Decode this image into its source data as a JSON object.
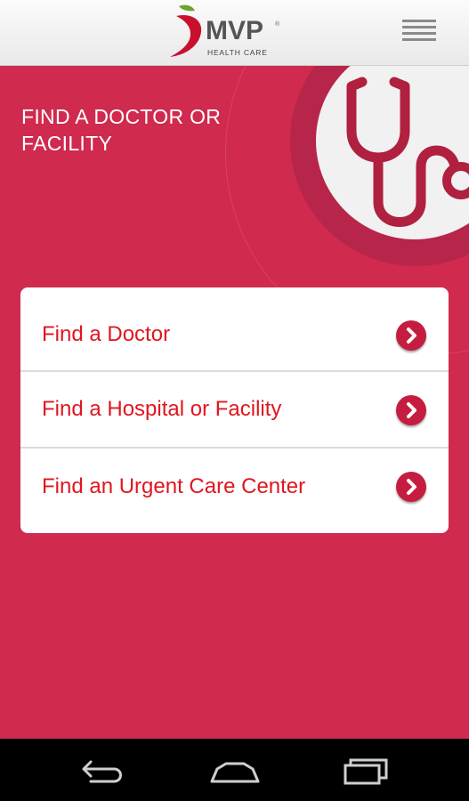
{
  "header": {
    "logo_text": "MVP",
    "logo_registered": "®",
    "logo_subtitle": "HEALTH CARE",
    "menu_icon": "hamburger-menu-icon"
  },
  "hero": {
    "title": "FIND A DOCTOR OR FACILITY",
    "illustration_icon": "stethoscope-icon"
  },
  "options": [
    {
      "label": "Find a Doctor",
      "icon": "chevron-right-icon"
    },
    {
      "label": "Find a Hospital or Facility",
      "icon": "chevron-right-icon"
    },
    {
      "label": "Find an Urgent Care Center",
      "icon": "chevron-right-icon"
    }
  ],
  "system_nav": {
    "back_icon": "back-icon",
    "home_icon": "home-icon",
    "recents_icon": "recent-apps-icon"
  },
  "colors": {
    "background": "#d02a4f",
    "accent_red": "#e0161f",
    "chevron_bg": "#c51d40",
    "stethoscope": "#b0203f"
  }
}
